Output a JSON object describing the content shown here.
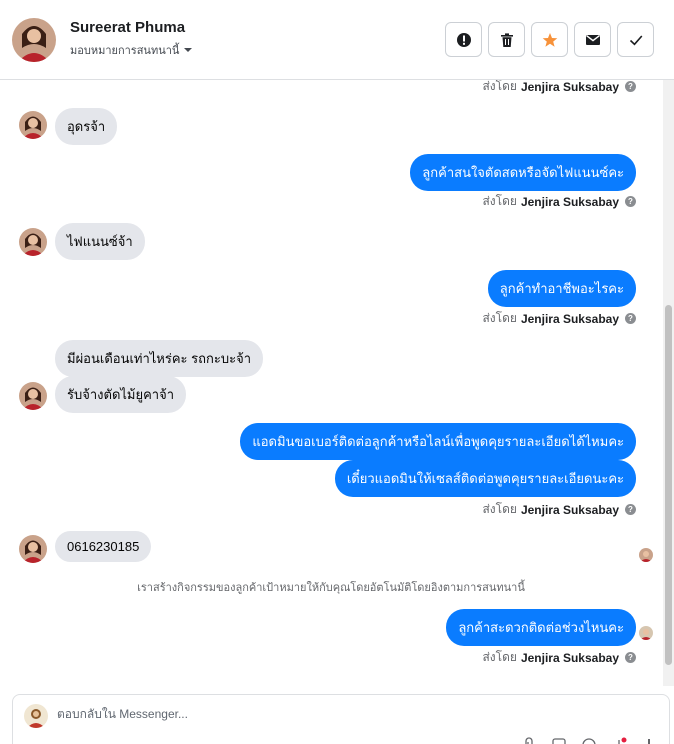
{
  "header": {
    "name": "Sureerat Phuma",
    "assign_label": "มอบหมายการสนทนานี้",
    "actions": [
      {
        "name": "report-button",
        "icon": "alert-icon"
      },
      {
        "name": "delete-button",
        "icon": "trash-icon"
      },
      {
        "name": "star-button",
        "icon": "star-icon"
      },
      {
        "name": "mail-button",
        "icon": "mail-icon"
      },
      {
        "name": "done-button",
        "icon": "check-icon"
      }
    ]
  },
  "sent_by": {
    "prefix": "ส่งโดย",
    "agent": "Jenjira Suksabay",
    "help": "?"
  },
  "messages": {
    "m1": "อุดรจ้า",
    "m2": "ลูกค้าสนใจตัดสดหรือจัดไฟแนนซ์คะ",
    "m3": "ไฟแนนซ์จ้า",
    "m4": "ลูกค้าทำอาชีพอะไรคะ",
    "m5": "มีผ่อนเดือนเท่าไหร่คะ รถกะบะจ้า",
    "m6": "รับจ้างตัดไม้ยูคาจ้า",
    "m7": "แอดมินขอเบอร์ติดต่อลูกค้าหรือไลน์เพื่อพูดคุยรายละเอียดได้ไหมคะ",
    "m8": "เดี๋ยวแอดมินให้เซลส์ติดต่อพูดคุยรายละเอียดนะคะ",
    "m9": "0616230185",
    "m10": "ลูกค้าสะดวกติดต่อช่วงไหนคะ"
  },
  "system_note": "เราสร้างกิจกรรมของลูกค้าเป้าหมายให้กับคุณโดยอัตโนมัติโดยอิงตามการสนทนานี้",
  "composer": {
    "placeholder": "ตอบกลับใน Messenger..."
  },
  "colors": {
    "outgoing": "#0a7cff",
    "incoming": "#e4e6eb",
    "star": "#f7923a"
  }
}
